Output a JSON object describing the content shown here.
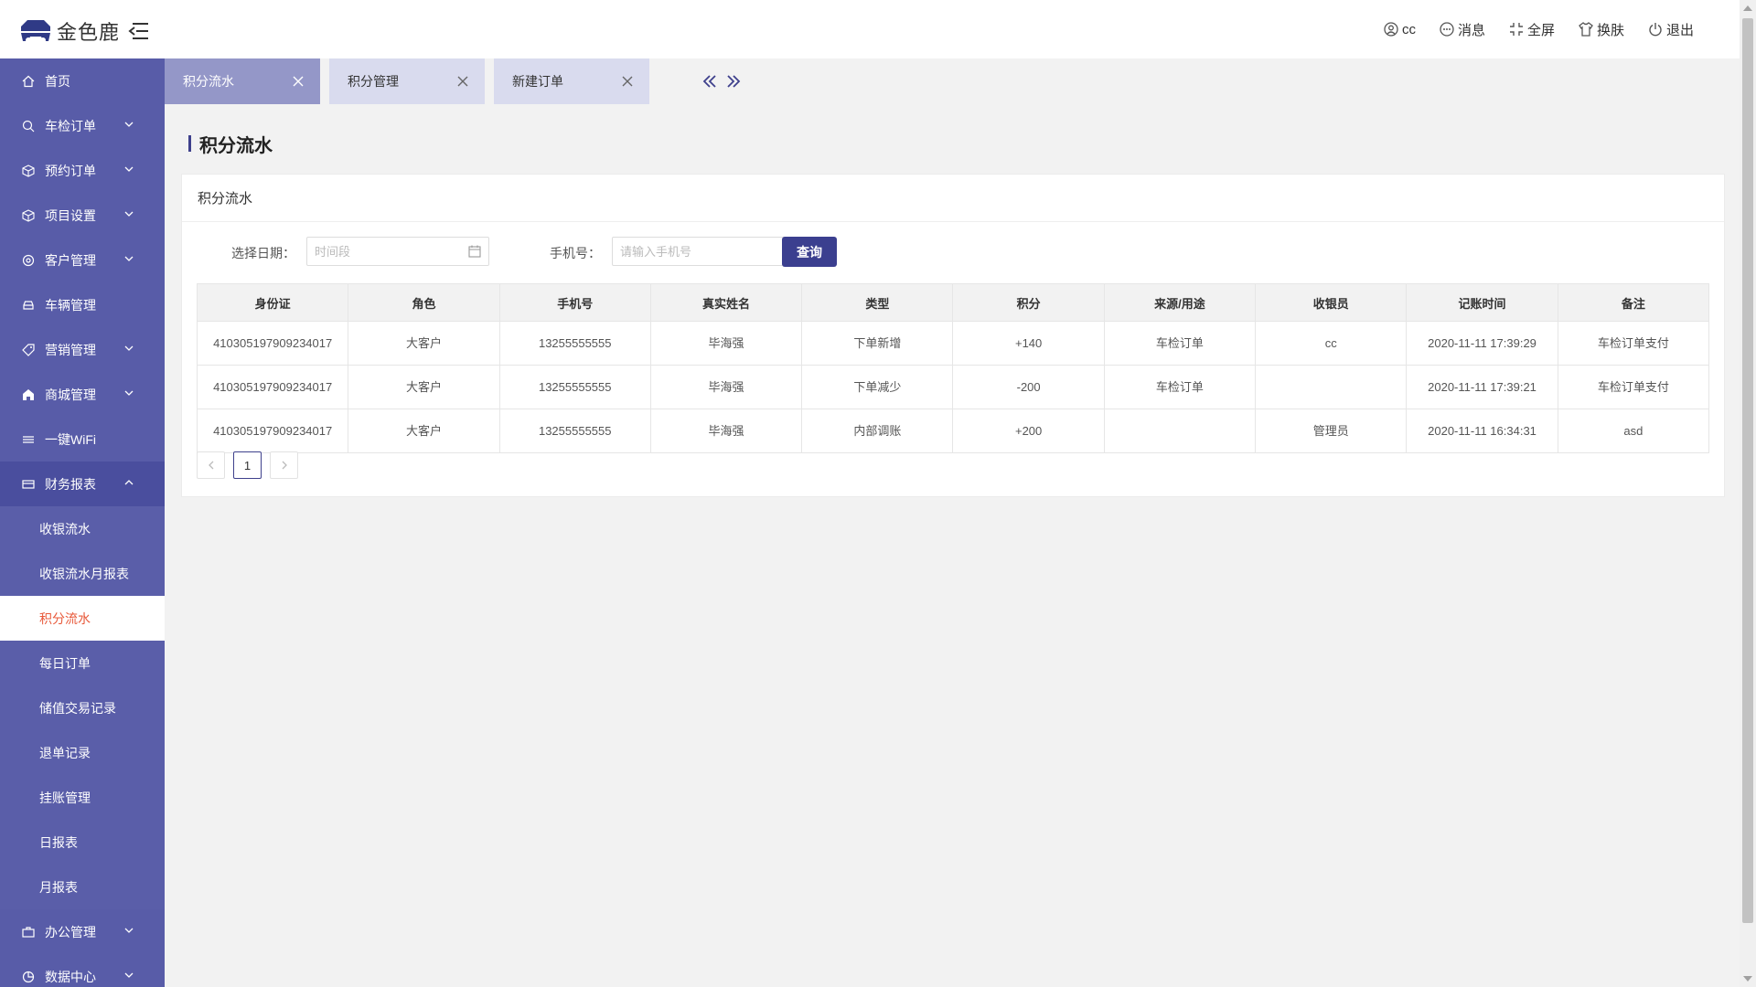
{
  "app": {
    "logo_text": "金色鹿"
  },
  "header": {
    "actions": [
      {
        "label": "cc",
        "icon": "user-icon"
      },
      {
        "label": "消息",
        "icon": "message-icon"
      },
      {
        "label": "全屏",
        "icon": "fullscreen-icon"
      },
      {
        "label": "换肤",
        "icon": "shirt-icon"
      },
      {
        "label": "退出",
        "icon": "power-icon"
      }
    ]
  },
  "sidebar": {
    "items": [
      {
        "label": "首页",
        "icon": "home-icon",
        "expandable": false
      },
      {
        "label": "车检订单",
        "icon": "search-icon",
        "expandable": true
      },
      {
        "label": "预约订单",
        "icon": "cube-icon",
        "expandable": true
      },
      {
        "label": "项目设置",
        "icon": "cube-icon",
        "expandable": true
      },
      {
        "label": "客户管理",
        "icon": "gear-icon",
        "expandable": true
      },
      {
        "label": "车辆管理",
        "icon": "car-icon",
        "expandable": false
      },
      {
        "label": "营销管理",
        "icon": "tag-icon",
        "expandable": true
      },
      {
        "label": "商城管理",
        "icon": "shop-icon",
        "expandable": true
      },
      {
        "label": "一键WiFi",
        "icon": "wifi-icon",
        "expandable": false
      },
      {
        "label": "财务报表",
        "icon": "report-icon",
        "expandable": true,
        "open": true
      },
      {
        "label": "办公管理",
        "icon": "briefcase-icon",
        "expandable": true
      },
      {
        "label": "数据中心",
        "icon": "chart-icon",
        "expandable": true
      }
    ],
    "finance_sub": [
      "收银流水",
      "收银流水月报表",
      "积分流水",
      "每日订单",
      "储值交易记录",
      "退单记录",
      "挂账管理",
      "日报表",
      "月报表"
    ],
    "active_sub": "积分流水"
  },
  "tabs": [
    {
      "label": "积分流水",
      "active": true
    },
    {
      "label": "积分管理",
      "active": false
    },
    {
      "label": "新建订单",
      "active": false
    }
  ],
  "page": {
    "title": "积分流水",
    "card_title": "积分流水",
    "filters": {
      "date_label": "选择日期：",
      "date_placeholder": "时间段",
      "phone_label": "手机号：",
      "phone_placeholder": "请输入手机号",
      "query_label": "查询"
    },
    "table": {
      "columns": [
        "身份证",
        "角色",
        "手机号",
        "真实姓名",
        "类型",
        "积分",
        "来源/用途",
        "收银员",
        "记账时间",
        "备注"
      ],
      "rows": [
        [
          "410305197909234017",
          "大客户",
          "13255555555",
          "毕海强",
          "下单新增",
          "+140",
          "车检订单",
          "cc",
          "2020-11-11 17:39:29",
          "车检订单支付"
        ],
        [
          "410305197909234017",
          "大客户",
          "13255555555",
          "毕海强",
          "下单减少",
          "-200",
          "车检订单",
          "",
          "2020-11-11 17:39:21",
          "车检订单支付"
        ],
        [
          "410305197909234017",
          "大客户",
          "13255555555",
          "毕海强",
          "内部调账",
          "+200",
          "",
          "管理员",
          "2020-11-11 16:34:31",
          "asd"
        ]
      ]
    },
    "pagination": {
      "current": "1"
    }
  },
  "colors": {
    "sidebar": "#3e408c",
    "accent": "#3b3f8f",
    "active_sub_text": "#e8593a"
  }
}
